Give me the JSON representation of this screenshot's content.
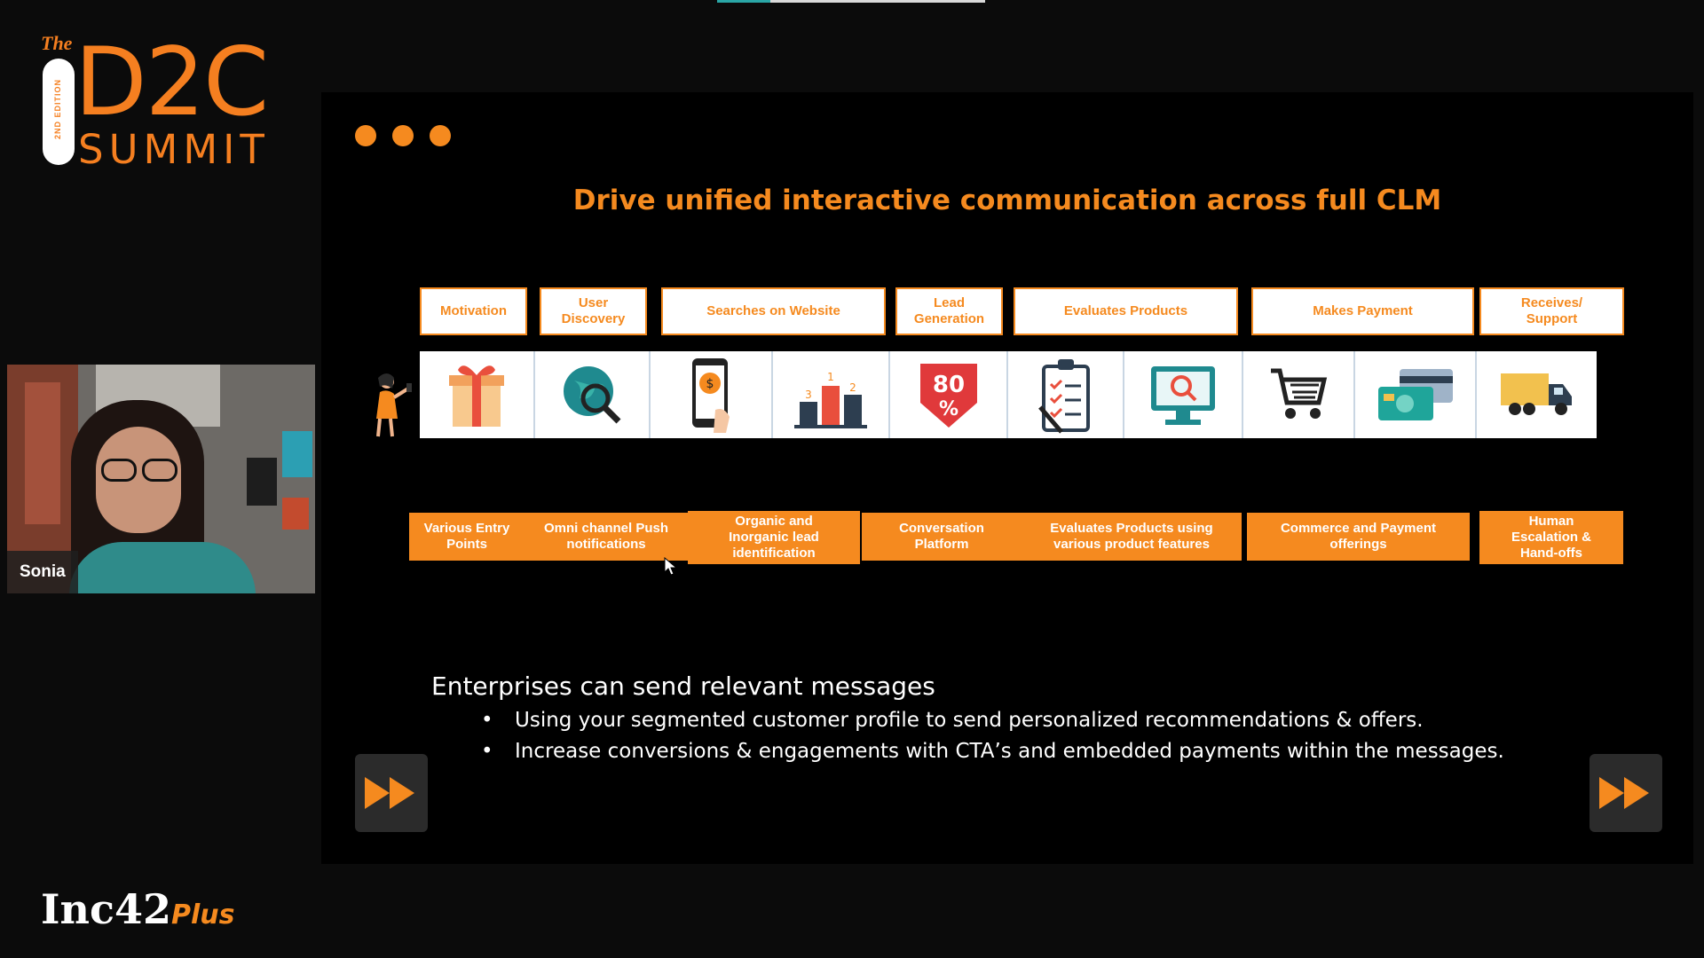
{
  "event": {
    "logo_the": "The",
    "logo_edition": "2ND EDITION",
    "logo_main": "D2C",
    "logo_sub": "SUMMIT"
  },
  "speaker": {
    "name": "Sonia"
  },
  "slide": {
    "title": "Drive unified interactive communication across full CLM",
    "stages": [
      "Motivation",
      "User Discovery",
      "Searches on Website",
      "Lead Generation",
      "Evaluates Products",
      "Makes Payment",
      "Receives/ Support"
    ],
    "icons": [
      "gift-icon",
      "globe-search-icon",
      "mobile-payment-icon",
      "podium-chart-icon",
      "discount-tag-icon",
      "checklist-icon",
      "monitor-search-icon",
      "shopping-cart-icon",
      "credit-card-icon",
      "delivery-truck-icon"
    ],
    "discount_text_top": "80",
    "discount_text_bottom": "%",
    "features": [
      "Various Entry Points",
      "Omni channel Push notifications",
      "Organic and Inorganic lead identification",
      "Conversation Platform",
      "Evaluates Products using various product features",
      "Commerce and Payment offerings",
      "Human Escalation & Hand-offs"
    ],
    "message_heading": "Enterprises can send relevant messages",
    "bullets": [
      "Using your segmented customer profile to send personalized recommendations & offers.",
      "Increase conversions & engagements with CTA’s and embedded payments within the messages."
    ]
  },
  "footer": {
    "brand_main": "Inc42",
    "brand_plus": "Plus"
  },
  "colors": {
    "accent": "#f58a1f",
    "background": "#0b0b0b"
  }
}
